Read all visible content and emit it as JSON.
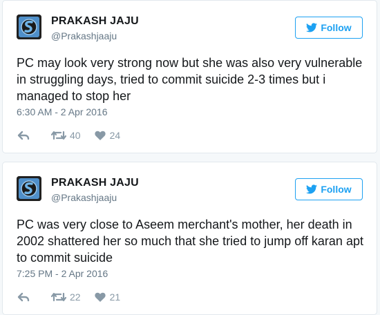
{
  "tweets": [
    {
      "name": "PRAKASH JAJU",
      "handle": "@Prakashjaaju",
      "follow_label": "Follow",
      "text": "PC may look very strong now but she was also very vulnerable in struggling days, tried to commit suicide 2-3 times but i managed to stop her",
      "timestamp": "6:30 AM - 2 Apr 2016",
      "retweets": "40",
      "likes": "24"
    },
    {
      "name": "PRAKASH JAJU",
      "handle": "@Prakashjaaju",
      "follow_label": "Follow",
      "text": "PC was very close to Aseem merchant's mother, her death in 2002 shattered her so much that she tried to jump off karan apt to commit suicide",
      "timestamp": "7:25 PM - 2 Apr 2016",
      "retweets": "22",
      "likes": "21"
    }
  ],
  "colors": {
    "accent": "#1da1f2",
    "text": "#14171a",
    "muted": "#657786",
    "action": "#8899a6",
    "border": "#e1e8ed",
    "background": "#f5f8fa"
  },
  "icons": {
    "follow": "twitter-bird-icon",
    "reply": "reply-icon",
    "retweet": "retweet-icon",
    "like": "heart-icon"
  }
}
